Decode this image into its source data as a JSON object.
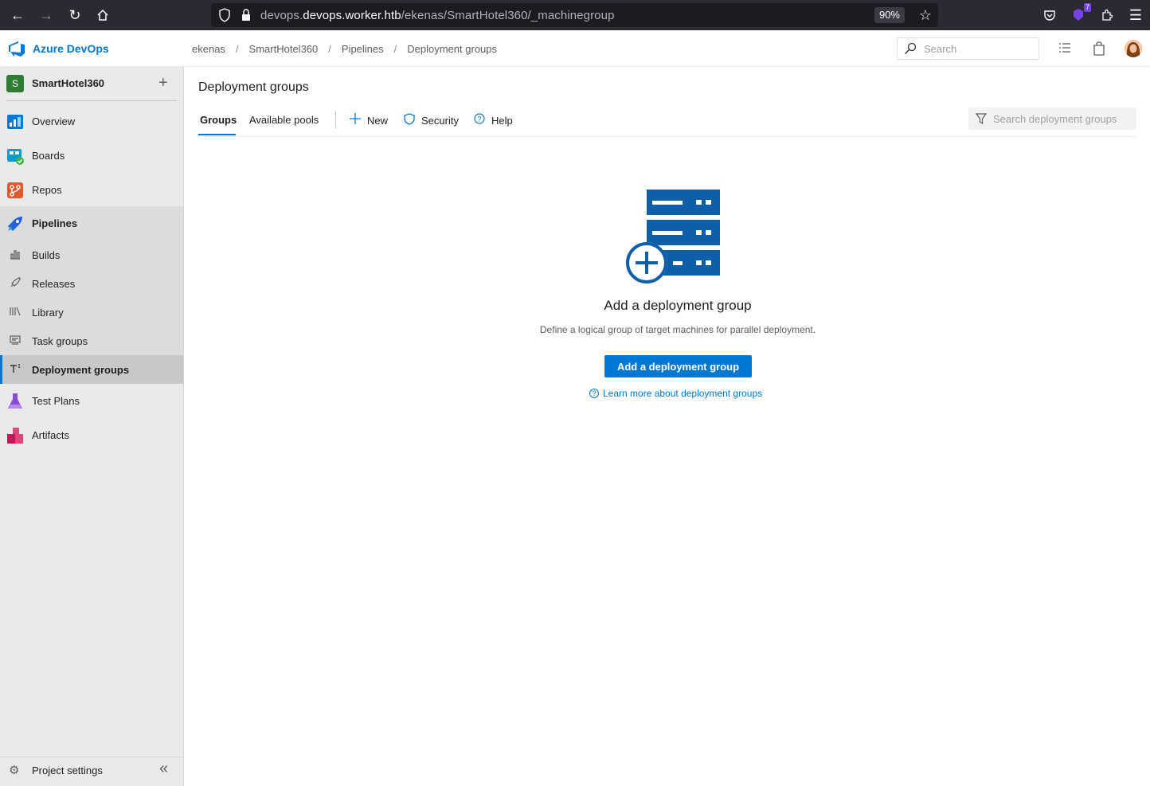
{
  "browser": {
    "url_host": "devops.worker.htb",
    "url_path": "/ekenas/SmartHotel360/_machinegroup",
    "zoom": "90%",
    "notif_count": "7"
  },
  "header": {
    "app_title": "Azure DevOps",
    "breadcrumb": [
      "ekenas",
      "SmartHotel360",
      "Pipelines",
      "Deployment groups"
    ],
    "search_placeholder": "Search"
  },
  "sidebar": {
    "project_initial": "S",
    "project_name": "SmartHotel360",
    "items": [
      {
        "label": "Overview"
      },
      {
        "label": "Boards"
      },
      {
        "label": "Repos"
      },
      {
        "label": "Pipelines"
      }
    ],
    "pipelines_sub": [
      {
        "label": "Builds"
      },
      {
        "label": "Releases"
      },
      {
        "label": "Library"
      },
      {
        "label": "Task groups"
      },
      {
        "label": "Deployment groups"
      }
    ],
    "items_after": [
      {
        "label": "Test Plans"
      },
      {
        "label": "Artifacts"
      }
    ],
    "settings_label": "Project settings"
  },
  "main": {
    "title": "Deployment groups",
    "tabs": [
      "Groups",
      "Available pools"
    ],
    "commands": {
      "new": "New",
      "security": "Security",
      "help": "Help"
    },
    "filter_placeholder": "Search deployment groups",
    "empty": {
      "title": "Add a deployment group",
      "description": "Define a logical group of target machines for parallel deployment.",
      "button": "Add a deployment group",
      "link": "Learn more about deployment groups"
    }
  },
  "colors": {
    "accent": "#0078d4",
    "project_badge": "#2e7d32"
  }
}
